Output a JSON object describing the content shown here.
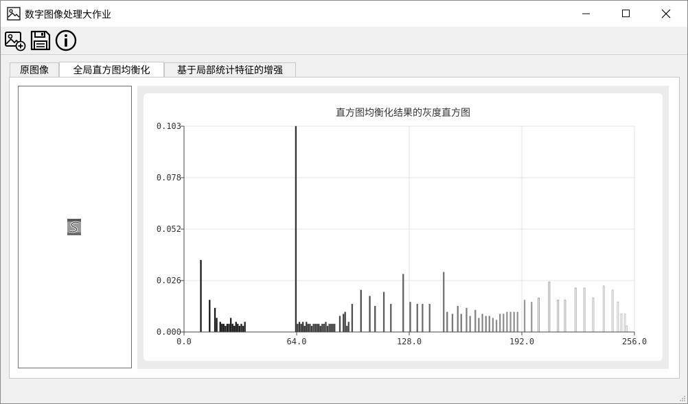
{
  "window": {
    "title": "数字图像处理大作业"
  },
  "toolbar": {
    "open_icon": "image-add-icon",
    "save_icon": "floppy-disk-icon",
    "info_icon": "info-circle-icon"
  },
  "tabs": [
    {
      "label": "原图像",
      "active": false
    },
    {
      "label": "全局直方图均衡化",
      "active": true
    },
    {
      "label": "基于局部统计特征的增强",
      "active": false
    }
  ],
  "chart_data": {
    "type": "bar",
    "title": "直方图均衡化结果的灰度直方图",
    "xlabel": "",
    "ylabel": "",
    "xlim": [
      0,
      256
    ],
    "ylim": [
      0,
      0.103
    ],
    "x_ticks": [
      "0.0",
      "64.0",
      "128.0",
      "192.0",
      "256.0"
    ],
    "y_ticks": [
      "0.000",
      "0.026",
      "0.052",
      "0.078",
      "0.103"
    ],
    "grid": true,
    "bars": [
      {
        "x": 9,
        "y": 0.036
      },
      {
        "x": 14,
        "y": 0.016
      },
      {
        "x": 17,
        "y": 0.012
      },
      {
        "x": 18,
        "y": 0.007
      },
      {
        "x": 20,
        "y": 0.005
      },
      {
        "x": 21,
        "y": 0.004
      },
      {
        "x": 22,
        "y": 0.004
      },
      {
        "x": 23,
        "y": 0.003
      },
      {
        "x": 24,
        "y": 0.004
      },
      {
        "x": 25,
        "y": 0.004
      },
      {
        "x": 26,
        "y": 0.007
      },
      {
        "x": 27,
        "y": 0.004
      },
      {
        "x": 28,
        "y": 0.003
      },
      {
        "x": 29,
        "y": 0.005
      },
      {
        "x": 30,
        "y": 0.004
      },
      {
        "x": 31,
        "y": 0.003
      },
      {
        "x": 32,
        "y": 0.004
      },
      {
        "x": 33,
        "y": 0.003
      },
      {
        "x": 34,
        "y": 0.005
      },
      {
        "x": 63,
        "y": 0.103
      },
      {
        "x": 64,
        "y": 0.004
      },
      {
        "x": 65,
        "y": 0.005
      },
      {
        "x": 66,
        "y": 0.004
      },
      {
        "x": 67,
        "y": 0.005
      },
      {
        "x": 68,
        "y": 0.003
      },
      {
        "x": 69,
        "y": 0.005
      },
      {
        "x": 70,
        "y": 0.004
      },
      {
        "x": 71,
        "y": 0.004
      },
      {
        "x": 72,
        "y": 0.003
      },
      {
        "x": 73,
        "y": 0.004
      },
      {
        "x": 74,
        "y": 0.004
      },
      {
        "x": 75,
        "y": 0.004
      },
      {
        "x": 76,
        "y": 0.004
      },
      {
        "x": 77,
        "y": 0.003
      },
      {
        "x": 78,
        "y": 0.004
      },
      {
        "x": 79,
        "y": 0.004
      },
      {
        "x": 80,
        "y": 0.005
      },
      {
        "x": 81,
        "y": 0.003
      },
      {
        "x": 82,
        "y": 0.004
      },
      {
        "x": 83,
        "y": 0.004
      },
      {
        "x": 84,
        "y": 0.004
      },
      {
        "x": 85,
        "y": 0.004
      },
      {
        "x": 88,
        "y": 0.008
      },
      {
        "x": 90,
        "y": 0.009
      },
      {
        "x": 91,
        "y": 0.01
      },
      {
        "x": 92,
        "y": 0.003
      },
      {
        "x": 93,
        "y": 0.005
      },
      {
        "x": 95,
        "y": 0.014
      },
      {
        "x": 100,
        "y": 0.021
      },
      {
        "x": 105,
        "y": 0.018
      },
      {
        "x": 108,
        "y": 0.013
      },
      {
        "x": 113,
        "y": 0.02
      },
      {
        "x": 117,
        "y": 0.014
      },
      {
        "x": 124,
        "y": 0.029
      },
      {
        "x": 128,
        "y": 0.015
      },
      {
        "x": 132,
        "y": 0.014
      },
      {
        "x": 135,
        "y": 0.014
      },
      {
        "x": 139,
        "y": 0.014
      },
      {
        "x": 147,
        "y": 0.03
      },
      {
        "x": 149,
        "y": 0.01
      },
      {
        "x": 152,
        "y": 0.009
      },
      {
        "x": 155,
        "y": 0.013
      },
      {
        "x": 157,
        "y": 0.009
      },
      {
        "x": 160,
        "y": 0.012
      },
      {
        "x": 162,
        "y": 0.008
      },
      {
        "x": 165,
        "y": 0.011
      },
      {
        "x": 167,
        "y": 0.007
      },
      {
        "x": 169,
        "y": 0.009
      },
      {
        "x": 171,
        "y": 0.008
      },
      {
        "x": 173,
        "y": 0.008
      },
      {
        "x": 175,
        "y": 0.007
      },
      {
        "x": 177,
        "y": 0.006
      },
      {
        "x": 179,
        "y": 0.009
      },
      {
        "x": 181,
        "y": 0.009
      },
      {
        "x": 183,
        "y": 0.01
      },
      {
        "x": 185,
        "y": 0.01
      },
      {
        "x": 187,
        "y": 0.01
      },
      {
        "x": 189,
        "y": 0.01
      },
      {
        "x": 193,
        "y": 0.016
      },
      {
        "x": 197,
        "y": 0.015
      },
      {
        "x": 201,
        "y": 0.017
      },
      {
        "x": 207,
        "y": 0.025
      },
      {
        "x": 212,
        "y": 0.016
      },
      {
        "x": 216,
        "y": 0.016
      },
      {
        "x": 222,
        "y": 0.022
      },
      {
        "x": 227,
        "y": 0.022
      },
      {
        "x": 232,
        "y": 0.017
      },
      {
        "x": 238,
        "y": 0.023
      },
      {
        "x": 243,
        "y": 0.021
      },
      {
        "x": 246,
        "y": 0.015
      },
      {
        "x": 248,
        "y": 0.009
      },
      {
        "x": 250,
        "y": 0.009
      },
      {
        "x": 251,
        "y": 0.003
      }
    ]
  }
}
